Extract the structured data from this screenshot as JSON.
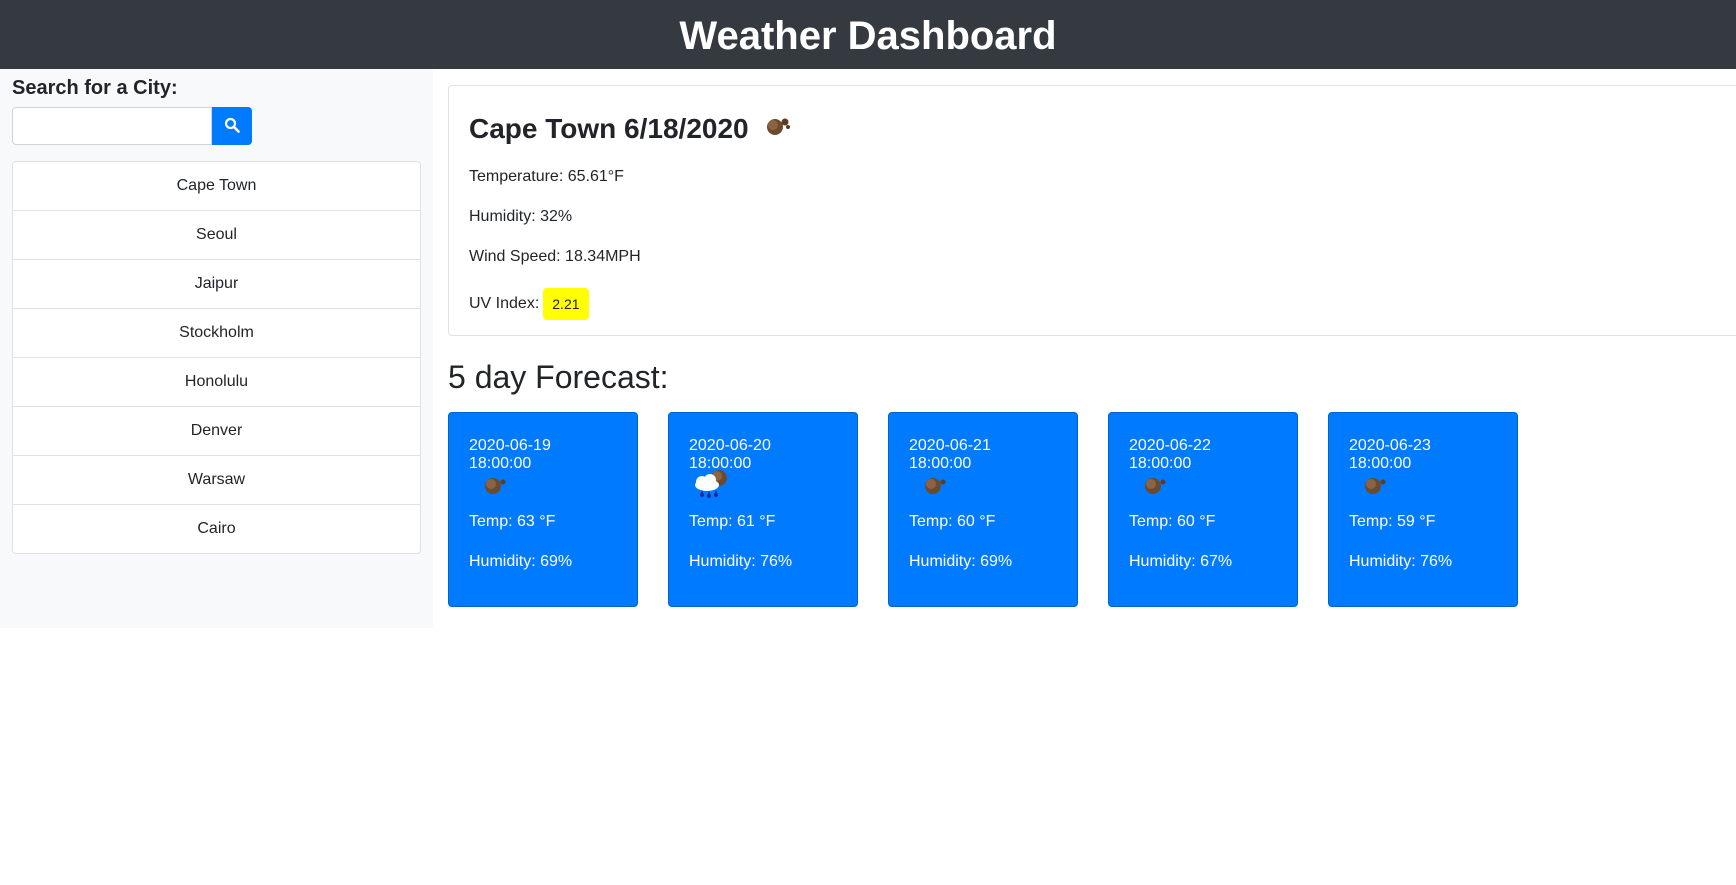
{
  "header": {
    "title": "Weather Dashboard"
  },
  "sidebar": {
    "search_label": "Search for a City:",
    "search_value": "",
    "search_icon": "search-icon",
    "cities": [
      "Cape Town",
      "Seoul",
      "Jaipur",
      "Stockholm",
      "Honolulu",
      "Denver",
      "Warsaw",
      "Cairo"
    ]
  },
  "current": {
    "title": "Cape Town 6/18/2020",
    "icon": "overcast-clouds-icon",
    "temperature": "Temperature: 65.61°F",
    "humidity": "Humidity: 32%",
    "wind": "Wind Speed: 18.34MPH",
    "uv_label": "UV Index:",
    "uv_value": "2.21",
    "uv_color": "#ffff00"
  },
  "forecast": {
    "title": "5 day Forecast:",
    "accent": "#007bff",
    "days": [
      {
        "date": "2020-06-19 18:00:00",
        "icon": "overcast-clouds-icon",
        "temp": "Temp: 63 °F",
        "humidity": "Humidity: 69%"
      },
      {
        "date": "2020-06-20 18:00:00",
        "icon": "rain-clouds-icon",
        "temp": "Temp: 61 °F",
        "humidity": "Humidity: 76%"
      },
      {
        "date": "2020-06-21 18:00:00",
        "icon": "overcast-clouds-icon",
        "temp": "Temp: 60 °F",
        "humidity": "Humidity: 69%"
      },
      {
        "date": "2020-06-22 18:00:00",
        "icon": "overcast-clouds-icon",
        "temp": "Temp: 60 °F",
        "humidity": "Humidity: 67%"
      },
      {
        "date": "2020-06-23 18:00:00",
        "icon": "overcast-clouds-icon",
        "temp": "Temp: 59 °F",
        "humidity": "Humidity: 76%"
      }
    ]
  }
}
